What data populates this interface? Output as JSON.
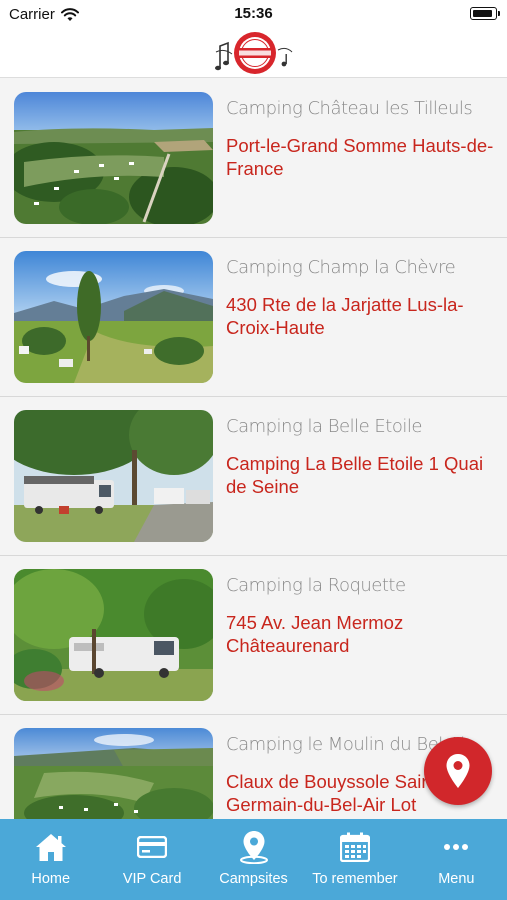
{
  "status_bar": {
    "carrier": "Carrier",
    "time": "15:36",
    "battery_level": 0.95
  },
  "header": {
    "logo_icon": "cest-si-bon-logo"
  },
  "campsites": [
    {
      "name": "Camping Château les Tilleuls",
      "address": "Port-le-Grand Somme Hauts-de-France",
      "image": "aerial-campsite-photo"
    },
    {
      "name": "Camping Champ la Chèvre",
      "address": "430 Rte de la Jarjatte Lus-la-Croix-Haute",
      "image": "mountain-campsite-photo"
    },
    {
      "name": "Camping la Belle Etoile",
      "address": "Camping La Belle Etoile 1 Quai de Seine",
      "image": "motorhomes-trees-photo"
    },
    {
      "name": "Camping la Roquette",
      "address": "745 Av. Jean Mermoz Châteaurenard",
      "image": "motorhome-under-trees-photo"
    },
    {
      "name": "Camping le Moulin du Bel-Air",
      "address": "Claux de Bouyssole Saint-Germain-du-Bel-Air Lot",
      "image": "valley-campsite-photo"
    }
  ],
  "map_button": {
    "icon": "map-pin-icon"
  },
  "tabs": [
    {
      "label": "Home",
      "icon": "home-icon"
    },
    {
      "label": "VIP Card",
      "icon": "card-icon"
    },
    {
      "label": "Campsites",
      "icon": "location-pin-icon"
    },
    {
      "label": "To remember",
      "icon": "calendar-icon"
    },
    {
      "label": "Menu",
      "icon": "more-dots-icon"
    }
  ],
  "colors": {
    "accent_red": "#c8261d",
    "tab_bar_blue": "#4ba8d8",
    "fab_red": "#d1272b"
  }
}
